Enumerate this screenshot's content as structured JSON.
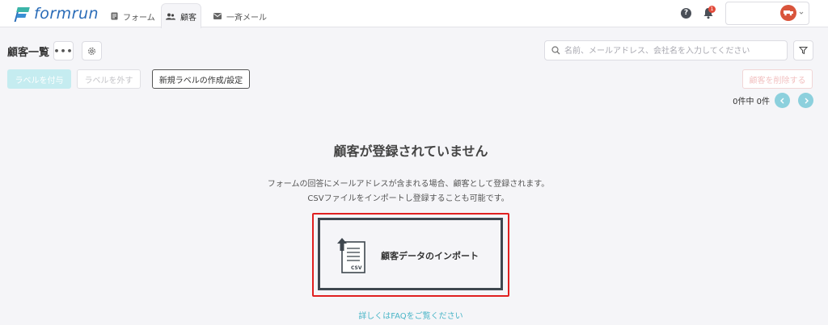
{
  "app": {
    "brand": "formrun"
  },
  "nav": {
    "forms": "フォーム",
    "customers": "顧客",
    "mail": "一斉メール"
  },
  "header": {
    "notification_count": "1",
    "help": "?"
  },
  "page": {
    "title": "顧客一覧",
    "more": "•••"
  },
  "search": {
    "placeholder": "名前、メールアドレス、会社名を入力してください",
    "value": ""
  },
  "toolbar": {
    "add_label": "ラベルを付与",
    "remove_label": "ラベルを外す",
    "new_label": "新規ラベルの作成/設定",
    "delete": "顧客を削除する"
  },
  "pagination": {
    "count_text": "0件中 0件"
  },
  "empty_state": {
    "title": "顧客が登録されていません",
    "desc_line1": "フォームの回答にメールアドレスが含まれる場合、顧客として登録されます。",
    "desc_line2": "CSVファイルをインポートし登録することも可能です。",
    "import_label": "顧客データのインポート",
    "csv_tag": "CSV",
    "faq_link": "詳しくはFAQをご覧ください"
  },
  "colors": {
    "accent": "#4ab5c7",
    "brand": "#2a6cb8",
    "highlight": "#e02020"
  },
  "icons": [
    "forms-icon",
    "customers-icon",
    "mail-icon",
    "help-icon",
    "bell-icon",
    "avatar-icon",
    "more-icon",
    "gear-icon",
    "search-icon",
    "filter-icon",
    "chevron-left-icon",
    "chevron-right-icon",
    "csv-upload-icon"
  ]
}
